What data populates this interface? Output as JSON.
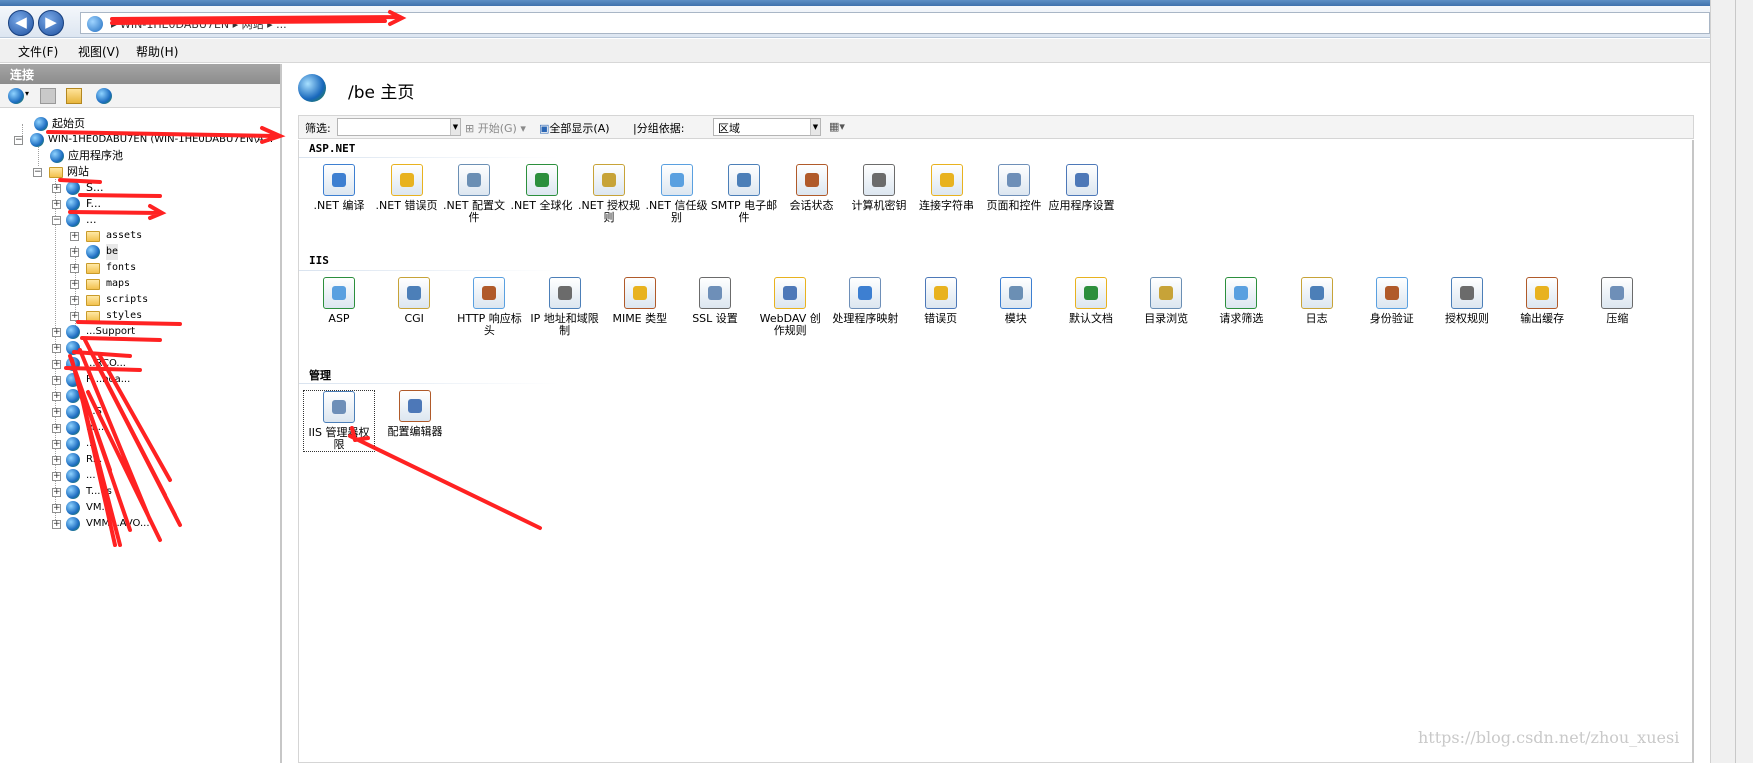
{
  "address_bar": {
    "text": "▸ WIN-1HE0DABU7EN ▸ 网站 ▸ ..."
  },
  "menu": [
    {
      "label": "文件(F)"
    },
    {
      "label": "视图(V)"
    },
    {
      "label": "帮助(H)"
    }
  ],
  "left_pane": {
    "header": "连接",
    "tree": [
      {
        "label": "起始页"
      },
      {
        "label": "WIN-1HE0DABU7EN (WIN-1HE0DABU7EN\\A..."
      },
      {
        "label": "应用程序池"
      },
      {
        "label": "网站"
      },
      {
        "label": "S..."
      },
      {
        "label": "F..."
      },
      {
        "label": "..."
      },
      {
        "label": "assets"
      },
      {
        "label": "be"
      },
      {
        "label": "fonts"
      },
      {
        "label": "maps"
      },
      {
        "label": "scripts"
      },
      {
        "label": "styles"
      },
      {
        "label": "...Support"
      },
      {
        "label": ""
      },
      {
        "label": "...RCO..."
      },
      {
        "label": "R...boa..."
      },
      {
        "label": ""
      },
      {
        "label": "...S"
      },
      {
        "label": "M..."
      },
      {
        "label": "..."
      },
      {
        "label": "R..."
      },
      {
        "label": "..."
      },
      {
        "label": "T...es"
      },
      {
        "label": "VM..."
      },
      {
        "label": "VMM...AVO..."
      }
    ]
  },
  "page": {
    "title": "/be 主页"
  },
  "filter_bar": {
    "filter_label": "筛选:",
    "start_label": "开始(G)",
    "show_all_label": "全部显示(A)",
    "group_by_label": "|分组依据:",
    "group_by_value": "区域"
  },
  "sections": [
    {
      "title": "ASP.NET",
      "items": [
        {
          "label": ".NET 编译",
          "icon": "dotnet-compile-icon"
        },
        {
          "label": ".NET 错误页",
          "icon": "dotnet-error-page-icon"
        },
        {
          "label": ".NET 配置文件",
          "icon": "dotnet-profile-icon"
        },
        {
          "label": ".NET 全球化",
          "icon": "dotnet-globalization-icon"
        },
        {
          "label": ".NET 授权规则",
          "icon": "dotnet-authorization-icon"
        },
        {
          "label": ".NET 信任级别",
          "icon": "dotnet-trust-level-icon"
        },
        {
          "label": "SMTP 电子邮件",
          "icon": "smtp-email-icon"
        },
        {
          "label": "会话状态",
          "icon": "session-state-icon"
        },
        {
          "label": "计算机密钥",
          "icon": "machine-key-icon"
        },
        {
          "label": "连接字符串",
          "icon": "connection-strings-icon"
        },
        {
          "label": "页面和控件",
          "icon": "pages-controls-icon"
        },
        {
          "label": "应用程序设置",
          "icon": "app-settings-icon"
        }
      ]
    },
    {
      "title": "IIS",
      "items": [
        {
          "label": "ASP",
          "icon": "asp-icon"
        },
        {
          "label": "CGI",
          "icon": "cgi-icon"
        },
        {
          "label": "HTTP 响应标头",
          "icon": "http-headers-icon"
        },
        {
          "label": "IP 地址和域限制",
          "icon": "ip-restrictions-icon"
        },
        {
          "label": "MIME 类型",
          "icon": "mime-types-icon"
        },
        {
          "label": "SSL 设置",
          "icon": "ssl-settings-icon"
        },
        {
          "label": "WebDAV 创作规则",
          "icon": "webdav-icon"
        },
        {
          "label": "处理程序映射",
          "icon": "handler-mappings-icon"
        },
        {
          "label": "错误页",
          "icon": "error-pages-icon"
        },
        {
          "label": "模块",
          "icon": "modules-icon"
        },
        {
          "label": "默认文档",
          "icon": "default-document-icon"
        },
        {
          "label": "目录浏览",
          "icon": "directory-browsing-icon"
        },
        {
          "label": "请求筛选",
          "icon": "request-filtering-icon"
        },
        {
          "label": "日志",
          "icon": "logging-icon"
        },
        {
          "label": "身份验证",
          "icon": "authentication-icon"
        },
        {
          "label": "授权规则",
          "icon": "authorization-rules-icon"
        },
        {
          "label": "输出缓存",
          "icon": "output-caching-icon"
        },
        {
          "label": "压缩",
          "icon": "compression-icon"
        }
      ]
    },
    {
      "title": "管理",
      "items": [
        {
          "label": "IIS 管理器权限",
          "icon": "iis-manager-permissions-icon"
        },
        {
          "label": "配置编辑器",
          "icon": "configuration-editor-icon"
        }
      ]
    }
  ],
  "watermark": "https://blog.csdn.net/zhou_xuesi",
  "colors": {
    "annotation_red": "#ff2222",
    "header_gray": "#9a9a9a"
  }
}
